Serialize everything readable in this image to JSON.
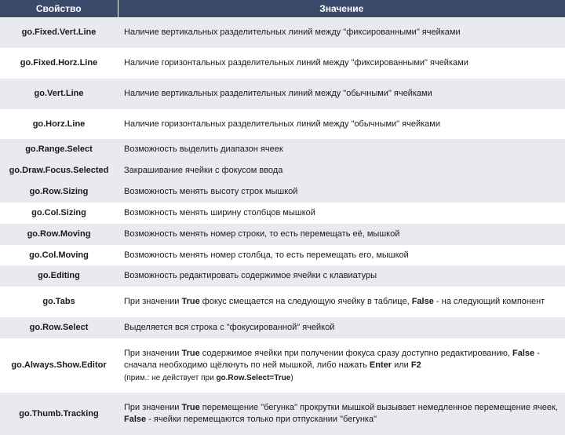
{
  "header": {
    "prop": "Свойство",
    "val": "Значение"
  },
  "rows": [
    {
      "prop": "go.Fixed.Vert.Line",
      "val": "Наличие вертикальных разделительных линий между \"фиксированными\" ячейками"
    },
    {
      "prop": "go.Fixed.Horz.Line",
      "val": "Наличие горизонтальных разделительных линий между \"фиксированными\" ячейками"
    },
    {
      "prop": "go.Vert.Line",
      "val": "Наличие вертикальных разделительных линий между \"обычными\" ячейками"
    },
    {
      "prop": "go.Horz.Line",
      "val": "Наличие горизонтальных разделительных линий между \"обычными\" ячейками"
    },
    {
      "prop": "go.Range.Select",
      "val": "Возможность выделить диапазон ячеек"
    },
    {
      "prop": "go.Draw.Focus.Selected",
      "val": "Закрашивание ячейки с фокусом ввода"
    },
    {
      "prop": "go.Row.Sizing",
      "val": "Возможность менять высоту строк мышкой"
    },
    {
      "prop": "go.Col.Sizing",
      "val": "Возможность менять ширину столбцов мышкой"
    },
    {
      "prop": "go.Row.Moving",
      "val": "Возможность менять номер строки, то есть перемещать её, мышкой"
    },
    {
      "prop": "go.Col.Moving",
      "val": "Возможность менять номер столбца, то есть перемещать его, мышкой"
    },
    {
      "prop": "go.Editing",
      "val": "Возможность редактировать содержимое ячейки с клавиатуры"
    },
    {
      "prop": "go.Tabs",
      "val": "При значении True фокус смещается на следующую ячейку в таблице, False - на следующий компонент"
    },
    {
      "prop": "go.Row.Select",
      "val": "Выделяется вся строка с \"фокусированной\" ячейкой"
    },
    {
      "prop": "go.Always.Show.Editor",
      "val": "При значении True содержимое ячейки при получении фокуса сразу доступно редактированию, False - сначала необходимо щёлкнуть по ней мышкой, либо нажать Enter или F2",
      "sub": "(прим.: не действует при go.Row.Select=True)"
    },
    {
      "prop": "go.Thumb.Tracking",
      "val": "При значении True перемещение \"бегунка\" прокрутки мышкой вызывает немедленное перемещение ячеек, False - ячейки перемещаются только при отпускании \"бегунка\""
    }
  ],
  "zebra": [
    "alt",
    "plain",
    "alt",
    "plain",
    "alt",
    "alt",
    "alt",
    "plain",
    "alt",
    "plain",
    "alt",
    "plain",
    "alt",
    "plain",
    "alt"
  ],
  "tall": [
    true,
    true,
    true,
    true,
    false,
    false,
    false,
    false,
    false,
    false,
    false,
    true,
    false,
    true,
    true
  ]
}
